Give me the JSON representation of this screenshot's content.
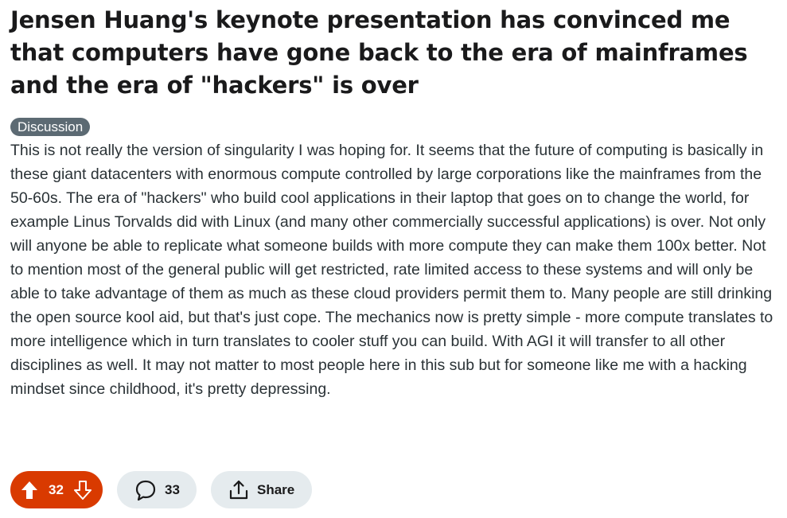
{
  "post": {
    "title": "Jensen Huang's keynote presentation has convinced me that computers have gone back to the era of mainframes and the era of \"hackers\" is over",
    "flair": "Discussion",
    "body": "This is not really the version of singularity I was hoping for. It seems that the future of computing is basically in these giant datacenters with enormous compute controlled by large corporations like the mainframes from the 50-60s. The era of \"hackers\" who build cool applications in their laptop that goes on to change the world, for example Linus Torvalds did with Linux (and many other commercially successful applications) is over. Not only will anyone be able to replicate what someone builds with more compute they can make them 100x better. Not to mention most of the general public will get restricted, rate limited access to these systems and will only be able to take advantage of them as much as these cloud providers permit them to. Many people are still drinking the open source kool aid, but that's just cope. The mechanics now is pretty simple - more compute translates to more intelligence which in turn translates to cooler stuff you can build. With AGI it will transfer to all other disciplines as well. It may not matter to most people here in this sub but for someone like me with a hacking mindset since childhood, it's pretty depressing."
  },
  "actions": {
    "vote_count": "32",
    "comment_count": "33",
    "share_label": "Share"
  },
  "icons": {
    "upvote": "upvote-arrow-icon",
    "downvote": "downvote-arrow-icon",
    "comment": "comment-bubble-icon",
    "share": "share-arrow-icon"
  },
  "colors": {
    "upvoted_accent": "#d93a00",
    "button_bg": "#e5ebee",
    "flair_bg": "#5c6a73"
  }
}
